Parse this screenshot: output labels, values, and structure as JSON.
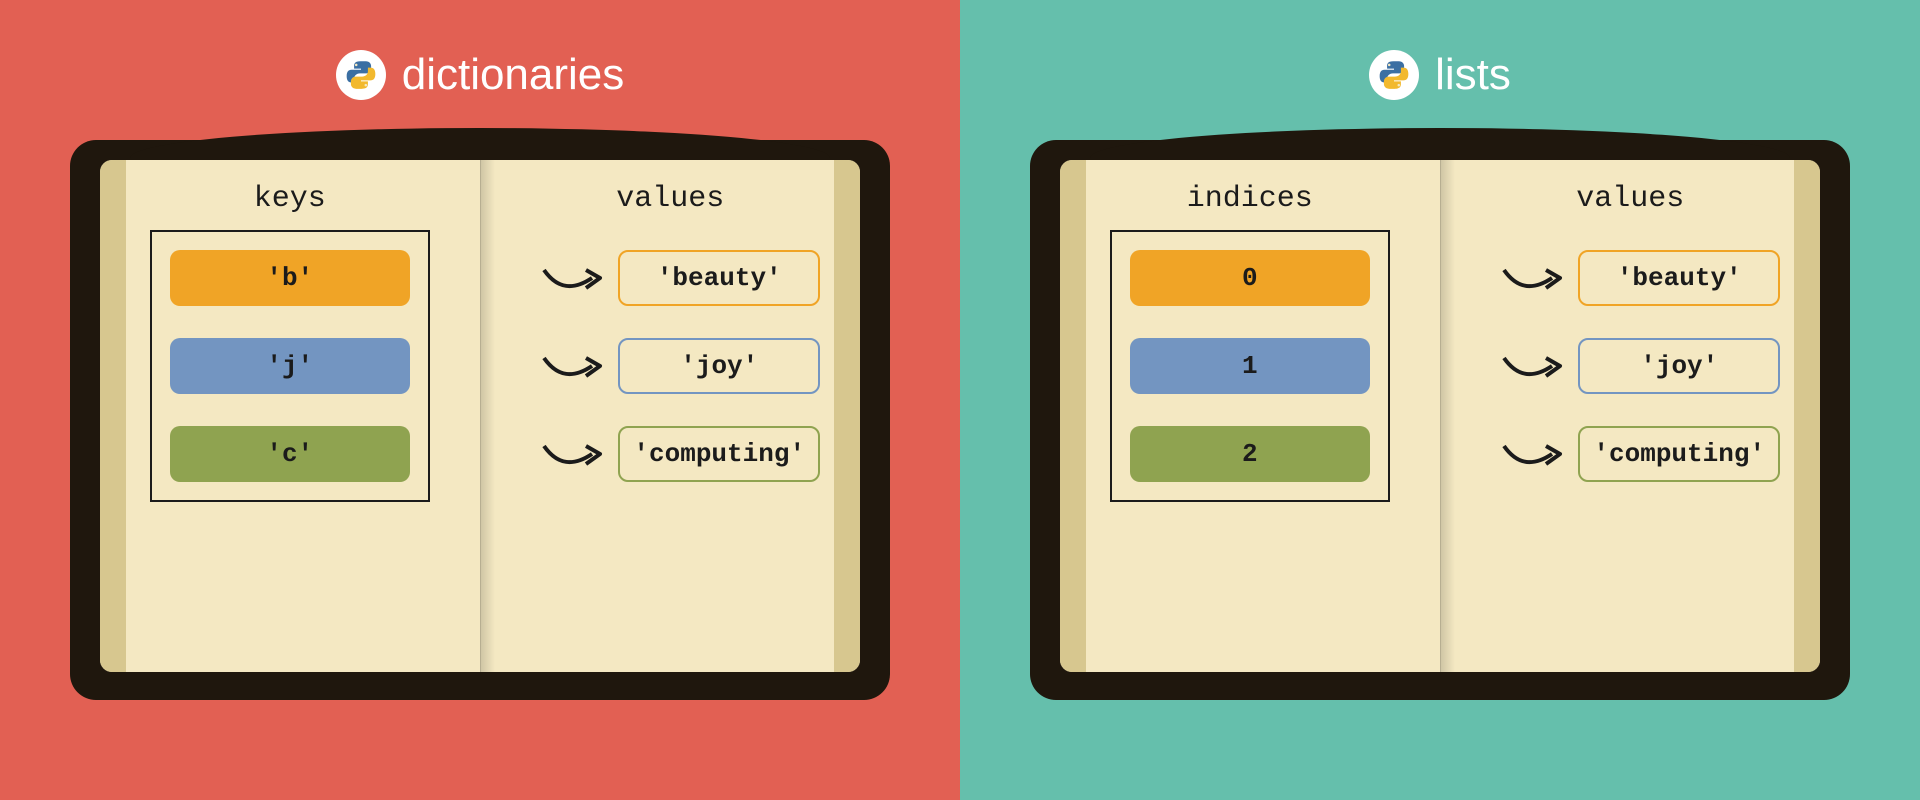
{
  "left": {
    "title": "dictionaries",
    "left_header": "keys",
    "right_header": "values",
    "items": [
      {
        "key": "'b'",
        "value": "'beauty'"
      },
      {
        "key": "'j'",
        "value": "'joy'"
      },
      {
        "key": "'c'",
        "value": "'computing'"
      }
    ]
  },
  "right": {
    "title": "lists",
    "left_header": "indices",
    "right_header": "values",
    "items": [
      {
        "key": "0",
        "value": "'beauty'"
      },
      {
        "key": "1",
        "value": "'joy'"
      },
      {
        "key": "2",
        "value": "'computing'"
      }
    ]
  },
  "colors": {
    "orange": "#F0A426",
    "blue": "#7395C1",
    "green": "#8FA350",
    "left_bg": "#E26053",
    "right_bg": "#65BFAC",
    "page": "#F4E8C2",
    "cover": "#1F170D"
  }
}
